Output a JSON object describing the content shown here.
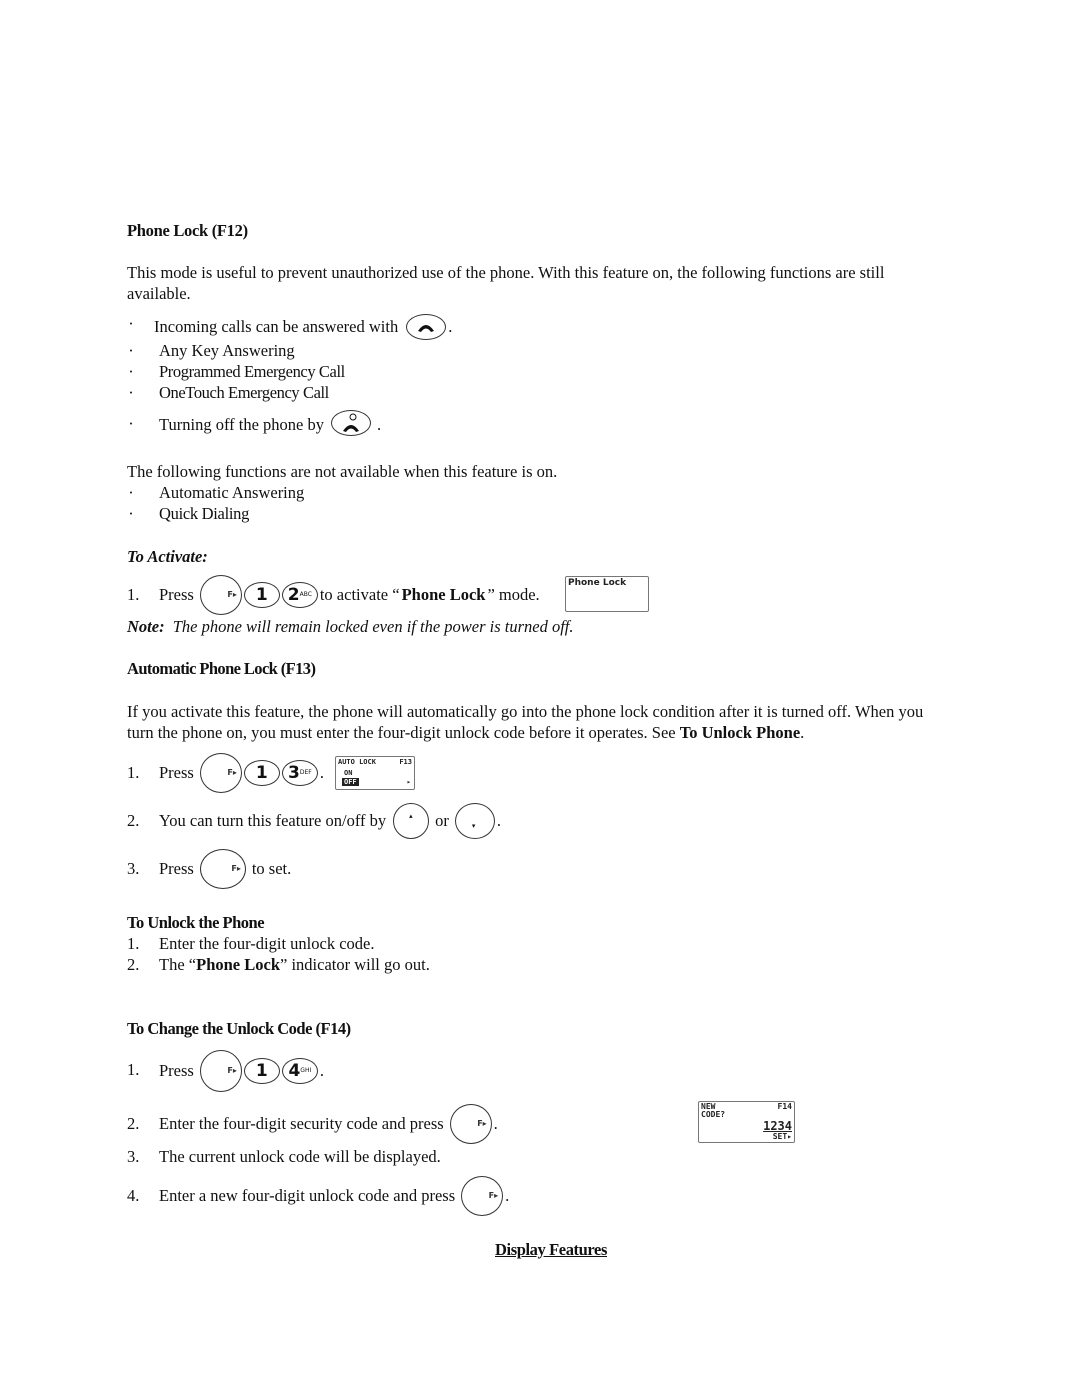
{
  "phone_lock": {
    "heading": "Phone Lock (F12)",
    "intro": "This mode is useful to prevent unauthorized use of the phone.  With this feature on, the following functions are still",
    "intro_cont": "available.",
    "available_bullet": "·",
    "available": [
      {
        "text": "Incoming calls can be answered with",
        "icon": "send-key-icon",
        "suffix": "."
      },
      {
        "text": "Any Key Answering"
      },
      {
        "text": "Programmed Emergency Call"
      },
      {
        "text": "OneTouch Emergency Call"
      },
      {
        "text": "Turning off the phone by",
        "icon": "end-power-key-icon",
        "suffix": "."
      }
    ],
    "not_available_intro": "The following functions are not available when this feature is on.",
    "not_available": [
      "Automatic Answering",
      "Quick Dialing"
    ],
    "activate_heading": "To Activate:",
    "activate_step": {
      "num": "1.",
      "press": "Press",
      "keys": [
        "F",
        "1",
        "2"
      ],
      "key_sub": [
        "",
        "",
        "ABC"
      ],
      "text_before": "to activate “",
      "bold": "Phone Lock",
      "text_after": "” mode.",
      "lcd": "Phone Lock"
    },
    "note_label": "Note:",
    "note_text": "The phone will remain locked even if the power is turned off."
  },
  "auto_lock": {
    "heading": "Automatic Phone Lock (F13)",
    "para_line1": "If you activate this feature, the phone will automatically go into the phone lock condition after it is turned off.  When you",
    "para_line2_pre": "turn the phone on, you must enter the four-digit unlock code before it operates.  See ",
    "para_line2_bold": "To Unlock Phone",
    "para_line2_post": ".",
    "steps": [
      {
        "num": "1.",
        "text": "Press",
        "keys": [
          "F",
          "1",
          "3"
        ],
        "key_sub": [
          "",
          "",
          "DEF"
        ],
        "suffix": ".",
        "lcd": {
          "title": "AUTO LOCK",
          "code": "F13",
          "line1": "ON",
          "line2": "OFF"
        }
      },
      {
        "num": "2.",
        "text": "You can turn this feature on/off by",
        "or": "or",
        "suffix": "."
      },
      {
        "num": "3.",
        "text": "Press",
        "suffix": "to set."
      }
    ]
  },
  "unlock": {
    "heading": "To Unlock the Phone",
    "steps": [
      {
        "num": "1.",
        "text": "Enter the four-digit unlock code."
      },
      {
        "num": "2.",
        "pre": "The “",
        "bold": "Phone Lock",
        "post": "” indicator will go out."
      }
    ]
  },
  "change_code": {
    "heading": "To Change the Unlock Code (F14)",
    "steps": [
      {
        "num": "1.",
        "text": "Press",
        "keys": [
          "F",
          "1",
          "4"
        ],
        "key_sub": [
          "",
          "",
          "GHI"
        ],
        "suffix": "."
      },
      {
        "num": "2.",
        "text": "Enter the four-digit security code and press",
        "suffix": "."
      },
      {
        "num": "3.",
        "text": "The current unlock code will be displayed."
      },
      {
        "num": "4.",
        "text": "Enter a new four-digit unlock code and press",
        "suffix": "."
      }
    ],
    "lcd": {
      "line1_left": "NEW",
      "line1_right": "F14",
      "line2": "CODE?",
      "code": "1234",
      "soft": "SET▸"
    }
  },
  "footer_link": "Display Features"
}
